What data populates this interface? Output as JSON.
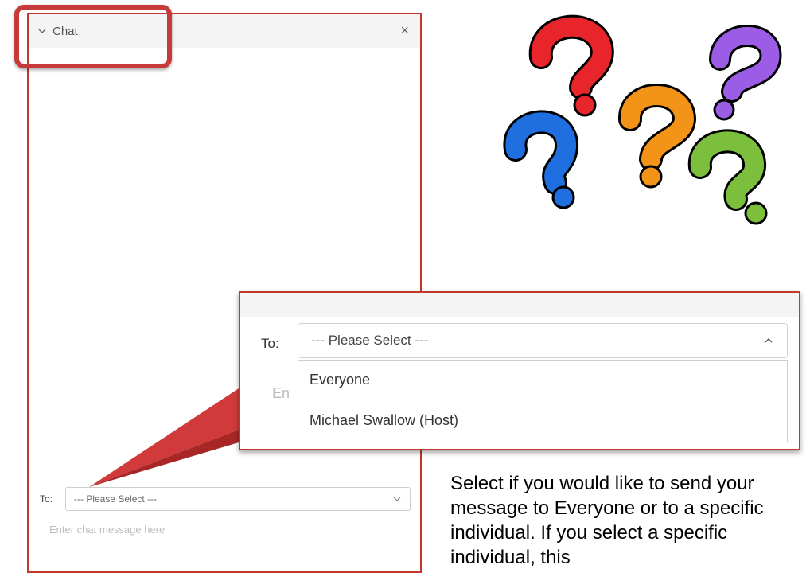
{
  "chat_panel": {
    "title": "Chat",
    "close_symbol": "×",
    "to_label": "To:",
    "select_placeholder": "--- Please Select ---",
    "message_placeholder": "Enter chat message here"
  },
  "zoom": {
    "to_label": "To:",
    "select_placeholder": "--- Please Select ---",
    "enter_partial": "En",
    "options": [
      "Everyone",
      "Michael Swallow (Host)"
    ]
  },
  "instructions": {
    "text": "Select if you would like to send your message to Everyone or to a specific individual. If you select a specific individual, this"
  },
  "colors": {
    "highlight": "#c73a3a",
    "border": "#c0392b",
    "qm_red": "#e8252b",
    "qm_purple": "#9b5de5",
    "qm_blue": "#1f6fe0",
    "qm_orange": "#f39419",
    "qm_green": "#7cbf3d"
  },
  "icons": {
    "collapse": "chevron-down-icon",
    "close": "close-icon",
    "dropdown": "chevron-down-icon",
    "dropdown_open": "chevron-up-icon"
  }
}
